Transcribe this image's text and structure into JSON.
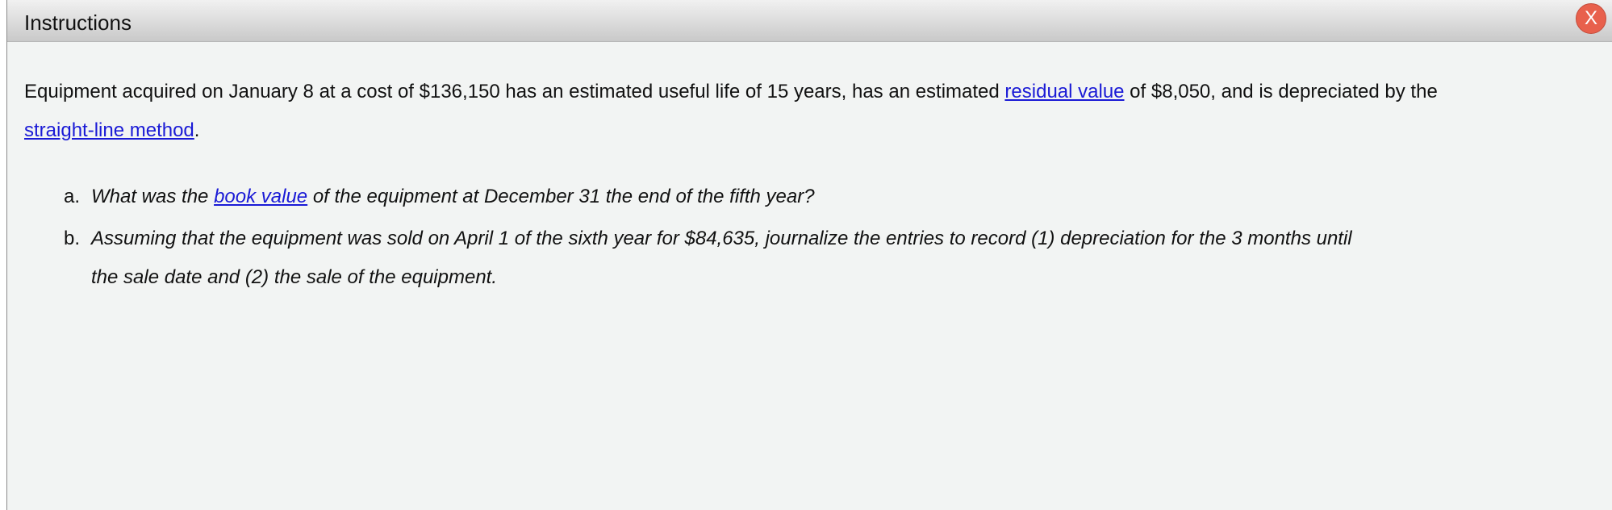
{
  "window": {
    "title": "Instructions",
    "close_label": "X"
  },
  "intro": {
    "part1": "Equipment acquired on January 8 at a cost of $136,150 has an estimated useful life of 15 years, has an estimated ",
    "link1": "residual value",
    "part2": " of $8,050, and is depreciated by the ",
    "link2": "straight-line method",
    "part3": "."
  },
  "questions": [
    {
      "marker": "a.",
      "part1": "What was the ",
      "link": "book value",
      "part2": " of the equipment at December 31 the end of the fifth year?"
    },
    {
      "marker": "b.",
      "text": "Assuming that the equipment was sold on April 1 of the sixth year for $84,635, journalize the entries to record (1) depreciation for the 3 months until the sale date and (2) the sale of the equipment."
    }
  ],
  "colors": {
    "link": "#1a1ad6",
    "close_button": "#e8604c",
    "background": "#f2f4f3"
  }
}
